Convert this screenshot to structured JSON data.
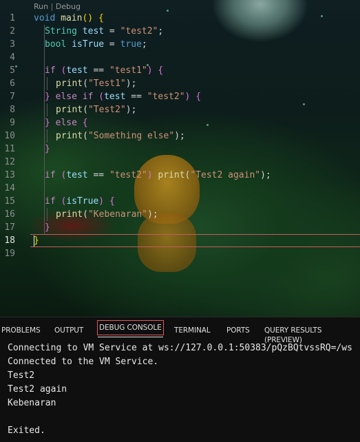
{
  "editor": {
    "codelens": {
      "run": "Run",
      "separator": "|",
      "debug": "Debug"
    },
    "line_numbers": [
      "1",
      "2",
      "3",
      "4",
      "5",
      "6",
      "7",
      "8",
      "9",
      "10",
      "11",
      "12",
      "13",
      "14",
      "15",
      "16",
      "17",
      "18",
      "19"
    ],
    "current_line": "18",
    "lines": [
      [
        [
          "kw",
          "void"
        ],
        [
          "pu",
          " "
        ],
        [
          "fn",
          "main"
        ],
        [
          "br1",
          "()"
        ],
        [
          "pu",
          " "
        ],
        [
          "br1",
          "{"
        ]
      ],
      [
        [
          "ty",
          "String"
        ],
        [
          "pu",
          " "
        ],
        [
          "id",
          "test"
        ],
        [
          "pu",
          " = "
        ],
        [
          "str",
          "\"test2\""
        ],
        [
          "pu",
          ";"
        ]
      ],
      [
        [
          "ty",
          "bool"
        ],
        [
          "pu",
          " "
        ],
        [
          "id",
          "isTrue"
        ],
        [
          "pu",
          " = "
        ],
        [
          "kw",
          "true"
        ],
        [
          "pu",
          ";"
        ]
      ],
      [],
      [
        [
          "ctl",
          "if"
        ],
        [
          "pu",
          " "
        ],
        [
          "br2",
          "("
        ],
        [
          "id",
          "test"
        ],
        [
          "pu",
          " == "
        ],
        [
          "str",
          "\"test1\""
        ],
        [
          "br2",
          ")"
        ],
        [
          "pu",
          " "
        ],
        [
          "br2",
          "{"
        ]
      ],
      [
        [
          "fn",
          "print"
        ],
        [
          "pu",
          "("
        ],
        [
          "str",
          "\"Test1\""
        ],
        [
          "pu",
          ");"
        ]
      ],
      [
        [
          "br2",
          "}"
        ],
        [
          "pu",
          " "
        ],
        [
          "ctl",
          "else"
        ],
        [
          "pu",
          " "
        ],
        [
          "ctl",
          "if"
        ],
        [
          "pu",
          " "
        ],
        [
          "br2",
          "("
        ],
        [
          "id",
          "test"
        ],
        [
          "pu",
          " == "
        ],
        [
          "str",
          "\"test2\""
        ],
        [
          "br2",
          ")"
        ],
        [
          "pu",
          " "
        ],
        [
          "br2",
          "{"
        ]
      ],
      [
        [
          "fn",
          "print"
        ],
        [
          "pu",
          "("
        ],
        [
          "str",
          "\"Test2\""
        ],
        [
          "pu",
          ");"
        ]
      ],
      [
        [
          "br2",
          "}"
        ],
        [
          "pu",
          " "
        ],
        [
          "ctl",
          "else"
        ],
        [
          "pu",
          " "
        ],
        [
          "br2",
          "{"
        ]
      ],
      [
        [
          "fn",
          "print"
        ],
        [
          "pu",
          "("
        ],
        [
          "str",
          "\"Something else\""
        ],
        [
          "pu",
          ");"
        ]
      ],
      [
        [
          "br2",
          "}"
        ]
      ],
      [],
      [
        [
          "ctl",
          "if"
        ],
        [
          "pu",
          " "
        ],
        [
          "br2",
          "("
        ],
        [
          "id",
          "test"
        ],
        [
          "pu",
          " == "
        ],
        [
          "str",
          "\"test2\""
        ],
        [
          "br2",
          ")"
        ],
        [
          "pu",
          " "
        ],
        [
          "fn",
          "print"
        ],
        [
          "pu",
          "("
        ],
        [
          "str",
          "\"Test2 again\""
        ],
        [
          "pu",
          ");"
        ]
      ],
      [],
      [
        [
          "ctl",
          "if"
        ],
        [
          "pu",
          " "
        ],
        [
          "br2",
          "("
        ],
        [
          "id",
          "isTrue"
        ],
        [
          "br2",
          ")"
        ],
        [
          "pu",
          " "
        ],
        [
          "br2",
          "{"
        ]
      ],
      [
        [
          "fn",
          "print"
        ],
        [
          "pu",
          "("
        ],
        [
          "str",
          "\"Kebenaran\""
        ],
        [
          "pu",
          ");"
        ]
      ],
      [
        [
          "br2",
          "}"
        ]
      ],
      [
        [
          "br1",
          "}"
        ]
      ],
      []
    ]
  },
  "panel": {
    "tabs": [
      {
        "id": "problems",
        "label": "PROBLEMS"
      },
      {
        "id": "output",
        "label": "OUTPUT"
      },
      {
        "id": "debug-console",
        "label": "DEBUG CONSOLE",
        "active": true
      },
      {
        "id": "terminal",
        "label": "TERMINAL"
      },
      {
        "id": "ports",
        "label": "PORTS"
      },
      {
        "id": "query-results",
        "label": "QUERY RESULTS (PREVIEW)"
      }
    ],
    "console_lines": [
      "Connecting to VM Service at ws://127.0.0.1:50383/pQzBQtvssRQ=/ws",
      "Connected to the VM Service.",
      "Test2",
      "Test2 again",
      "Kebenaran",
      "",
      "Exited."
    ]
  },
  "colors": {
    "keyword": "#569cd6",
    "type": "#4ec9b0",
    "identifier": "#9cdcfe",
    "function": "#dcdcaa",
    "string": "#ce9178",
    "control": "#c586c0",
    "bracket_outer": "#ffd700",
    "bracket_inner": "#da70d6",
    "current_line_border": "#c65c5c",
    "active_tab_border": "#e05a5a"
  }
}
